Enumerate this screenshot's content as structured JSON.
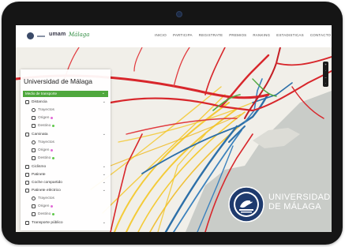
{
  "navbar": {
    "brand_primary": "umam",
    "brand_secondary": "Málaga",
    "menu": [
      "INICIO",
      "PARTICIPA",
      "REGISTRATE",
      "PREMIOS",
      "RANKING",
      "ESTADISTICAS",
      "CONTACTO"
    ]
  },
  "panel": {
    "title": "Universidad de Málaga",
    "header": "Medio de transporte",
    "items": [
      {
        "label": "Distancia",
        "type": "group"
      },
      {
        "label": "Trayectos",
        "type": "sub"
      },
      {
        "label": "Origen",
        "type": "sub",
        "dot_color": "#e16ad6"
      },
      {
        "label": "Destino",
        "type": "sub",
        "dot_color": "#5fc84a"
      },
      {
        "label": "Caminata",
        "type": "group"
      },
      {
        "label": "Trayectos",
        "type": "sub"
      },
      {
        "label": "Origen",
        "type": "sub",
        "dot_color": "#e16ad6"
      },
      {
        "label": "Destino",
        "type": "sub",
        "dot_color": "#5fc84a"
      },
      {
        "label": "Ciclismo",
        "type": "group"
      },
      {
        "label": "Patinete",
        "type": "group"
      },
      {
        "label": "Coche compartido",
        "type": "group"
      },
      {
        "label": "Patinete eléctrico",
        "type": "group"
      },
      {
        "label": "Trayectos",
        "type": "sub"
      },
      {
        "label": "Origen",
        "type": "sub",
        "dot_color": "#e16ad6"
      },
      {
        "label": "Destino",
        "type": "sub",
        "dot_color": "#5fc84a"
      },
      {
        "label": "Transporte público",
        "type": "group"
      }
    ]
  },
  "zoom_controls": [
    "+",
    "·",
    "–",
    "·"
  ],
  "university": {
    "line1": "UNIVERSIDAD",
    "line2": "DE MÁLAGA"
  },
  "colors": {
    "panel_header": "#4fa83d",
    "route_red": "#d8262b",
    "route_yellow": "#f4c624",
    "route_blue": "#2c6fa8",
    "sea": "#c9ccc8"
  }
}
